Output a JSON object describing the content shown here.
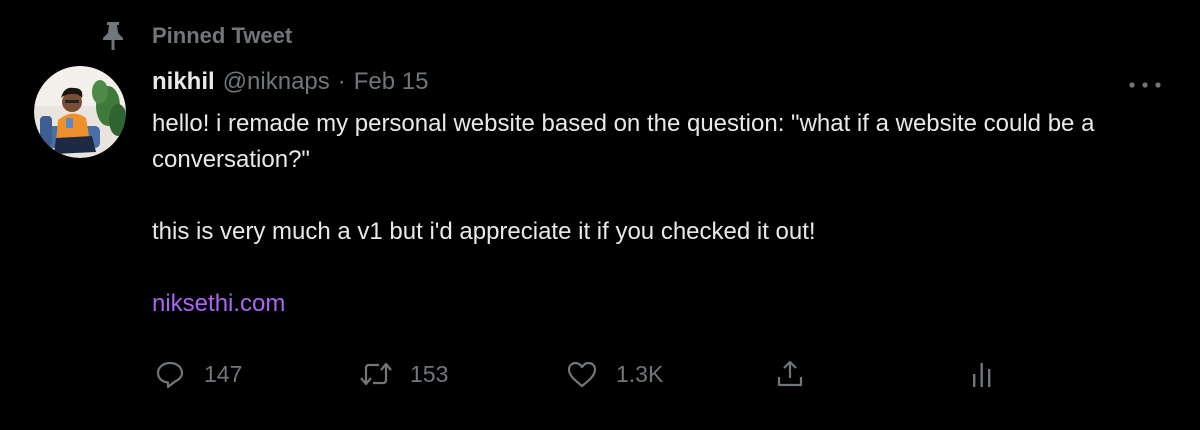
{
  "pinned": {
    "label": "Pinned Tweet",
    "icon": "pin-icon"
  },
  "author": {
    "display_name": "nikhil",
    "handle": "@niknaps",
    "separator": "·",
    "date": "Feb 15"
  },
  "tweet": {
    "line1": "hello! i remade my personal website based on the question: \"what if a website could be a conversation?\"",
    "line2": "this is very much a v1 but i'd appreciate it if you checked it out!",
    "link_text": "niksethi.com"
  },
  "actions": {
    "replies": "147",
    "retweets": "153",
    "likes": "1.3K"
  },
  "icons": {
    "pin": "pin-icon",
    "more": "more-icon",
    "reply": "reply-icon",
    "retweet": "retweet-icon",
    "like": "heart-icon",
    "share": "share-icon",
    "analytics": "analytics-icon"
  },
  "colors": {
    "background": "#000000",
    "text": "#e7e9ea",
    "muted": "#71767b",
    "link": "#a866f5"
  }
}
